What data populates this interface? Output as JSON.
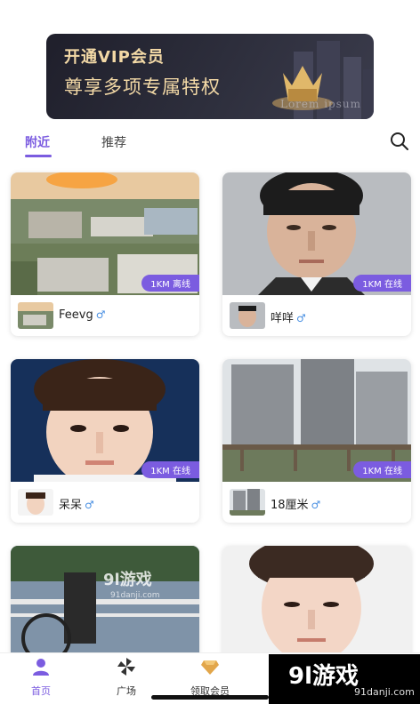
{
  "vip": {
    "title": "开通VIP会员",
    "subtitle": "尊享多项专属特权",
    "watermark": "Lorem ipsum"
  },
  "tabs": [
    {
      "label": "附近",
      "active": true
    },
    {
      "label": "推荐",
      "active": false
    }
  ],
  "cards": [
    {
      "name": "Feevg",
      "distance": "1KM 离线",
      "gender": "♂"
    },
    {
      "name": "咩咩",
      "distance": "1KM 在线",
      "gender": "♂"
    },
    {
      "name": "呆呆",
      "distance": "1KM 在线",
      "gender": "♂"
    },
    {
      "name": "18厘米",
      "distance": "1KM 在线",
      "gender": "♂"
    }
  ],
  "overlay_watermark": "9l游戏",
  "overlay_watermark_url": "91danji.com",
  "bottom_nav": [
    {
      "label": "首页",
      "icon": "user-icon",
      "active": true
    },
    {
      "label": "广场",
      "icon": "pinwheel-icon",
      "active": false
    },
    {
      "label": "领取会员",
      "icon": "diamond-icon",
      "active": false
    }
  ],
  "logo": {
    "main": "9l游戏",
    "url": "91danji.com"
  },
  "colors": {
    "accent": "#7b5ce0",
    "vip_gold": "#f3d9a6",
    "vip_bg": "#2b2c3a"
  }
}
